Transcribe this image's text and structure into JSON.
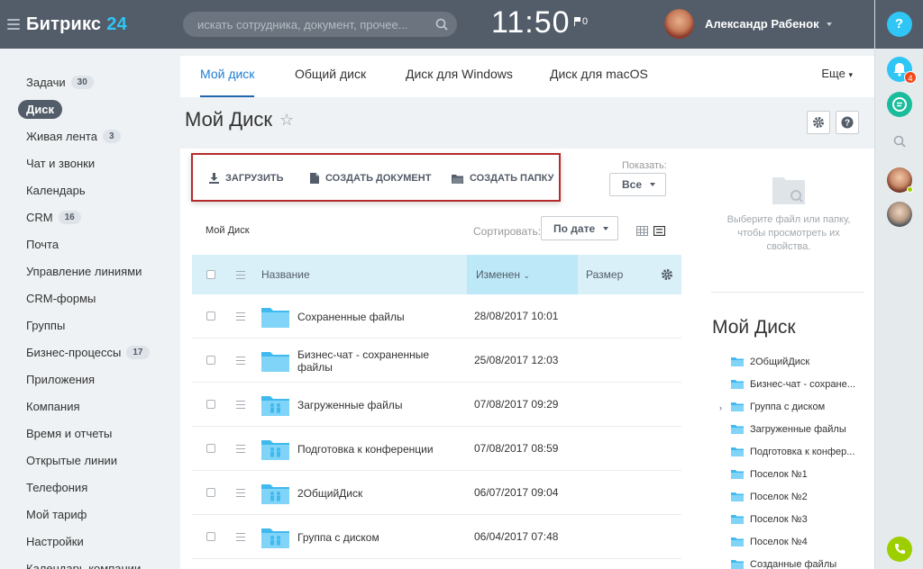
{
  "header": {
    "logo_text": "Битрикс",
    "logo_num": "24",
    "search_placeholder": "искать сотрудника, документ, прочее...",
    "time": "11:50",
    "flag_count": "0",
    "user_name": "Александр Рабенок"
  },
  "right_strip": {
    "help_label": "?",
    "notifications_count": "4"
  },
  "sidebar": {
    "items": [
      {
        "label": "Задачи",
        "count": "30"
      },
      {
        "label": "Диск",
        "count": null,
        "active": true
      },
      {
        "label": "Живая лента",
        "count": "3"
      },
      {
        "label": "Чат и звонки",
        "count": null
      },
      {
        "label": "Календарь",
        "count": null
      },
      {
        "label": "CRM",
        "count": "16"
      },
      {
        "label": "Почта",
        "count": null
      },
      {
        "label": "Управление линиями",
        "count": null
      },
      {
        "label": "CRM-формы",
        "count": null
      },
      {
        "label": "Группы",
        "count": null
      },
      {
        "label": "Бизнес-процессы",
        "count": "17"
      },
      {
        "label": "Приложения",
        "count": null
      },
      {
        "label": "Компания",
        "count": null
      },
      {
        "label": "Время и отчеты",
        "count": null
      },
      {
        "label": "Открытые линии",
        "count": null
      },
      {
        "label": "Телефония",
        "count": null
      },
      {
        "label": "Мой тариф",
        "count": null
      },
      {
        "label": "Настройки",
        "count": null
      },
      {
        "label": "Календарь компании",
        "count": null
      }
    ]
  },
  "tabs": [
    {
      "label": "Мой диск",
      "active": true
    },
    {
      "label": "Общий диск"
    },
    {
      "label": "Диск для Windows"
    },
    {
      "label": "Диск для macOS"
    }
  ],
  "tabs_more": "Еще",
  "page": {
    "title": "Мой Диск",
    "star": "☆"
  },
  "toolbar": {
    "upload": "ЗАГРУЗИТЬ",
    "create_doc": "СОЗДАТЬ ДОКУМЕНТ",
    "create_folder": "СОЗДАТЬ ПАПКУ",
    "show_label": "Показать:",
    "show_value": "Все"
  },
  "listing": {
    "breadcrumb": "Мой Диск",
    "sort_label": "Сортировать:",
    "sort_value": "По дате",
    "columns": {
      "name": "Название",
      "modified": "Изменен",
      "size": "Размер"
    },
    "rows": [
      {
        "name": "Сохраненные файлы",
        "date": "28/08/2017 10:01",
        "shared": false
      },
      {
        "name": "Бизнес-чат - сохраненные файлы",
        "date": "25/08/2017 12:03",
        "shared": false
      },
      {
        "name": "Загруженные файлы",
        "date": "07/08/2017 09:29",
        "shared": true
      },
      {
        "name": "Подготовка к конференции",
        "date": "07/08/2017 08:59",
        "shared": true
      },
      {
        "name": "2ОбщийДиск",
        "date": "06/07/2017 09:04",
        "shared": true
      },
      {
        "name": "Группа с диском",
        "date": "06/04/2017 07:48",
        "shared": true
      }
    ]
  },
  "side_panel": {
    "hint": "Выберите файл или папку, чтобы просмотреть их свойства.",
    "title": "Мой Диск",
    "tree": [
      {
        "label": "2ОбщийДиск"
      },
      {
        "label": "Бизнес-чат - сохране..."
      },
      {
        "label": "Группа с диском",
        "expandable": true
      },
      {
        "label": "Загруженные файлы"
      },
      {
        "label": "Подготовка к конфер..."
      },
      {
        "label": "Поселок №1"
      },
      {
        "label": "Поселок №2"
      },
      {
        "label": "Поселок №3"
      },
      {
        "label": "Поселок №4"
      },
      {
        "label": "Созданные файлы"
      }
    ]
  },
  "colors": {
    "topbar": "#535c69",
    "accent": "#2fc6f6",
    "folder": "#4fc3f7",
    "table_header": "#d9f0f9",
    "highlight_box": "#b52b2b"
  }
}
